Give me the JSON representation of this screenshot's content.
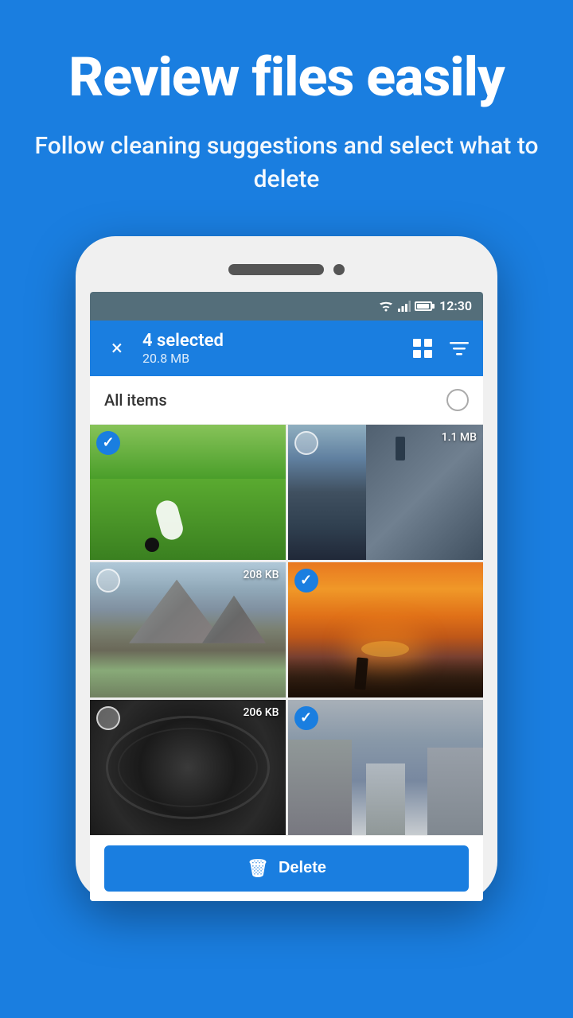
{
  "header": {
    "title": "Review files easily",
    "subtitle": "Follow cleaning suggestions and select what to delete"
  },
  "status_bar": {
    "time": "12:30"
  },
  "app_bar": {
    "selected_count": "4 selected",
    "selected_size": "20.8 MB",
    "close_label": "×",
    "grid_icon": "grid-icon",
    "sort_icon": "sort-icon"
  },
  "all_items": {
    "label": "All items"
  },
  "images": [
    {
      "id": "grass",
      "checked": true,
      "size": null
    },
    {
      "id": "cliff",
      "checked": false,
      "size": "1.1 MB"
    },
    {
      "id": "mountain",
      "checked": false,
      "size": "208 KB"
    },
    {
      "id": "sunset",
      "checked": true,
      "size": null
    },
    {
      "id": "spiral",
      "checked": false,
      "size": "206 KB"
    },
    {
      "id": "buildings",
      "checked": true,
      "size": null
    }
  ],
  "delete_button": {
    "label": "Delete"
  }
}
